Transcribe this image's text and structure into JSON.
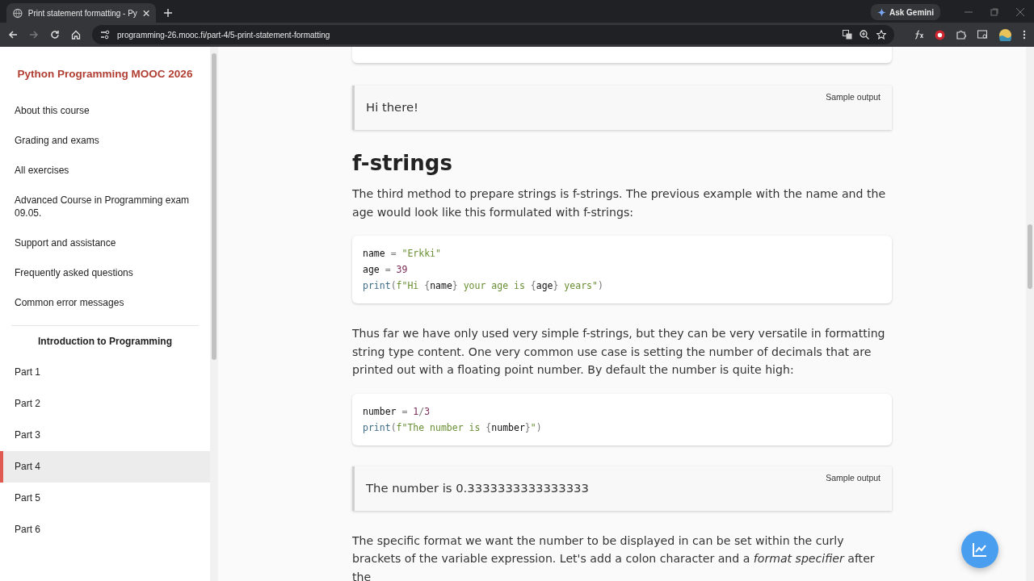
{
  "browser": {
    "tab_title": "Print statement formatting - Py",
    "url": "programming-26.mooc.fi/part-4/5-print-statement-formatting",
    "ask_button": "Ask Gemini"
  },
  "sidebar": {
    "title": "Python Programming MOOC 2026",
    "links": [
      {
        "label": "About this course"
      },
      {
        "label": "Grading and exams"
      },
      {
        "label": "All exercises"
      },
      {
        "label": "Advanced Course in Programming exam 09.05."
      },
      {
        "label": "Support and assistance"
      },
      {
        "label": "Frequently asked questions"
      },
      {
        "label": "Common error messages"
      }
    ],
    "section": "Introduction to Programming",
    "parts": [
      {
        "label": "Part 1",
        "selected": false
      },
      {
        "label": "Part 2",
        "selected": false
      },
      {
        "label": "Part 3",
        "selected": false
      },
      {
        "label": "Part 4",
        "selected": true
      },
      {
        "label": "Part 5",
        "selected": false
      },
      {
        "label": "Part 6",
        "selected": false
      }
    ]
  },
  "content": [
    {
      "kind": "cutcode"
    },
    {
      "kind": "output",
      "label": "Sample output",
      "text": "Hi there!"
    },
    {
      "kind": "heading",
      "text": "f-strings"
    },
    {
      "kind": "para",
      "text": "The third method to prepare strings is f-strings. The previous example with the name and the age would look like this formulated with f-strings:"
    },
    {
      "kind": "code",
      "lines": [
        [
          {
            "t": "name",
            "kind": "id"
          },
          {
            "t": " = ",
            "kind": "op"
          },
          {
            "t": "\"Erkki\"",
            "kind": "str"
          }
        ],
        [
          {
            "t": "age",
            "kind": "id"
          },
          {
            "t": " = ",
            "kind": "op"
          },
          {
            "t": "39",
            "kind": "num"
          }
        ],
        [
          {
            "t": "print",
            "kind": "fn"
          },
          {
            "t": "(",
            "kind": "op"
          },
          {
            "t": "f\"Hi ",
            "kind": "str"
          },
          {
            "t": "{",
            "kind": "op"
          },
          {
            "t": "name",
            "kind": "id"
          },
          {
            "t": "}",
            "kind": "op"
          },
          {
            "t": " your age is ",
            "kind": "str"
          },
          {
            "t": "{",
            "kind": "op"
          },
          {
            "t": "age",
            "kind": "id"
          },
          {
            "t": "}",
            "kind": "op"
          },
          {
            "t": " years\"",
            "kind": "str"
          },
          {
            "t": ")",
            "kind": "op"
          }
        ]
      ]
    },
    {
      "kind": "para",
      "text": "Thus far we have only used very simple f-strings, but they can be very versatile in formatting string type content. One very common use case is setting the number of decimals that are printed out with a floating point number. By default the number is quite high:"
    },
    {
      "kind": "code",
      "lines": [
        [
          {
            "t": "number",
            "kind": "id"
          },
          {
            "t": " = ",
            "kind": "op"
          },
          {
            "t": "1",
            "kind": "num"
          },
          {
            "t": "/",
            "kind": "op"
          },
          {
            "t": "3",
            "kind": "num"
          }
        ],
        [
          {
            "t": "print",
            "kind": "fn"
          },
          {
            "t": "(",
            "kind": "op"
          },
          {
            "t": "f\"The number is ",
            "kind": "str"
          },
          {
            "t": "{",
            "kind": "op"
          },
          {
            "t": "number",
            "kind": "id"
          },
          {
            "t": "}",
            "kind": "op"
          },
          {
            "t": "\"",
            "kind": "str"
          },
          {
            "t": ")",
            "kind": "op"
          }
        ]
      ]
    },
    {
      "kind": "output",
      "label": "Sample output",
      "text": "The number is 0.3333333333333333"
    },
    {
      "kind": "para",
      "text": "The specific format we want the number to be displayed in can be set within the curly brackets of the variable expression. Let's add a colon character and a *format specifier* after the"
    }
  ]
}
